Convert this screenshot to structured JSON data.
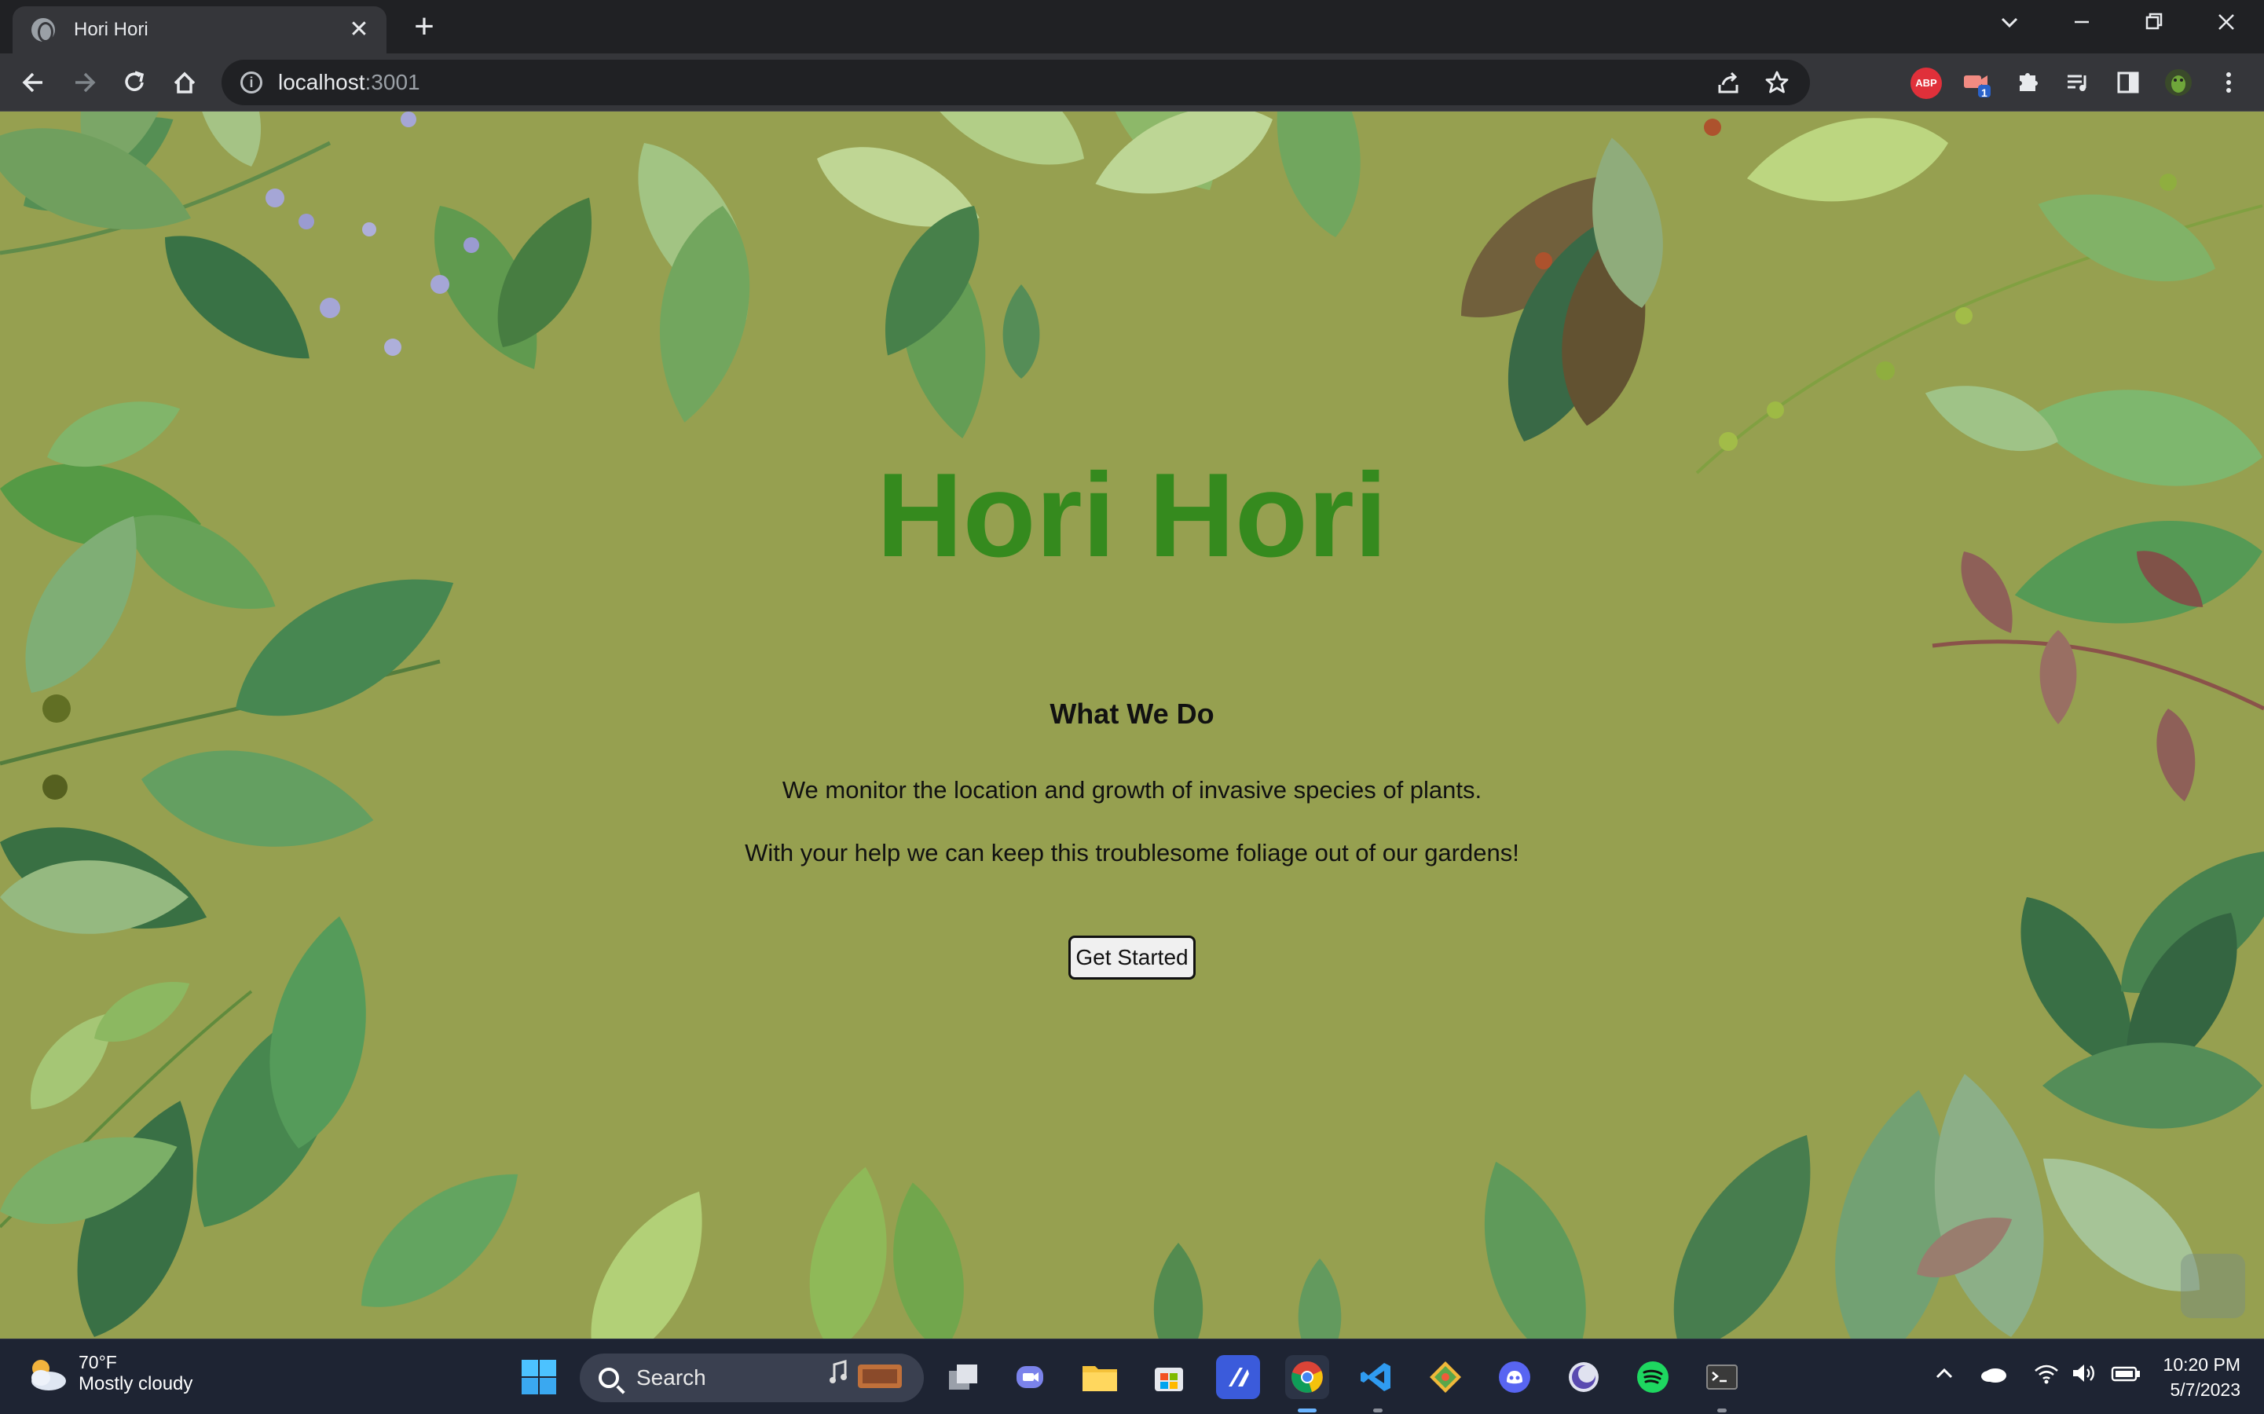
{
  "browser": {
    "tab_title": "Hori Hori",
    "tab_close": "✕",
    "new_tab": "+",
    "url_host": "localhost",
    "url_port": ":3001",
    "extensions": [
      {
        "name": "adblock-plus",
        "label": "ABP",
        "color": "#e0303a"
      },
      {
        "name": "camera-badge",
        "label": "1",
        "color": "#2a62c9"
      }
    ]
  },
  "page": {
    "background_color": "#96a050",
    "brand_title": "Hori Hori",
    "brand_color": "#358a1e",
    "section_heading": "What We Do",
    "paragraph_1": "We monitor the location and growth of invasive species of plants.",
    "paragraph_2": "With your help we can keep this troublesome foliage out of our gardens!",
    "cta_label": "Get Started"
  },
  "taskbar": {
    "weather_temp": "70°F",
    "weather_condition": "Mostly cloudy",
    "search_label": "Search",
    "time": "10:20 PM",
    "date": "5/7/2023"
  }
}
